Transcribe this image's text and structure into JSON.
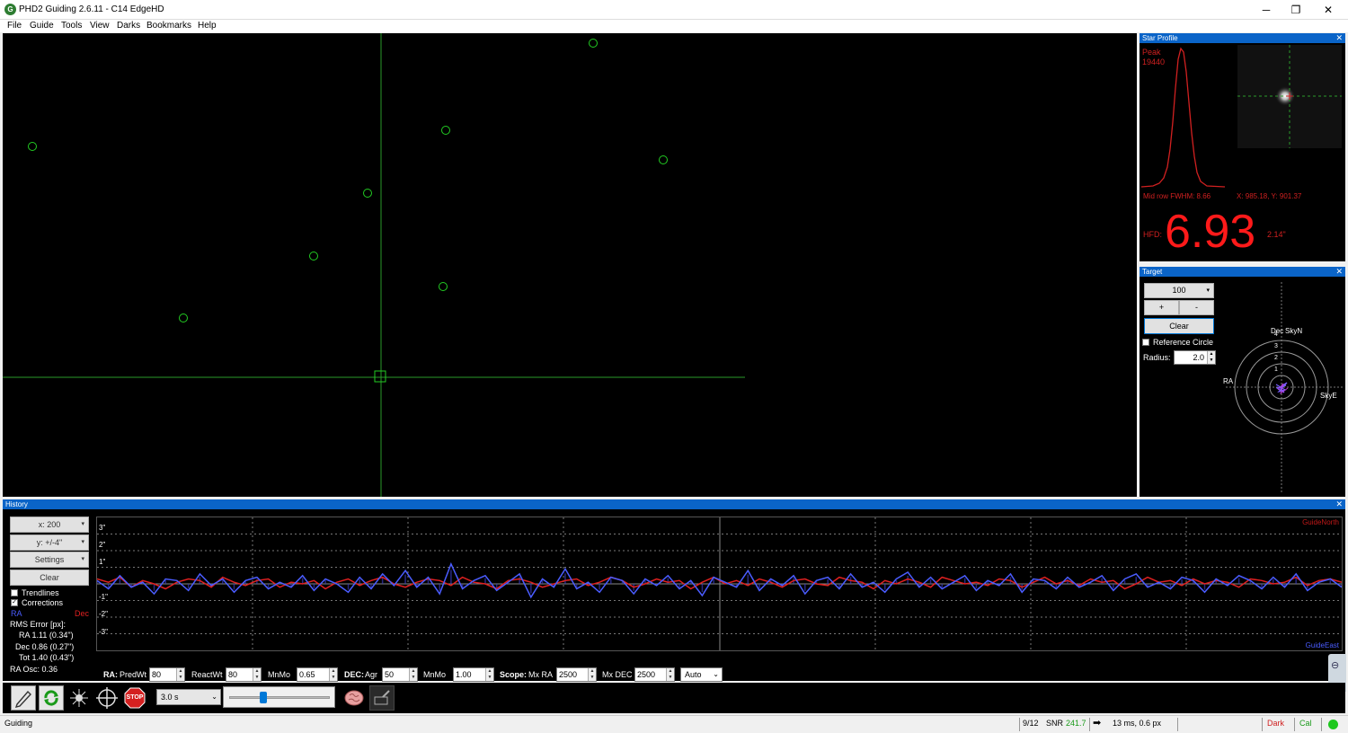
{
  "window": {
    "title": "PHD2 Guiding 2.6.11 - C14 EdgeHD",
    "minimize": "─",
    "maximize": "❐",
    "close": "✕"
  },
  "menu": [
    "File",
    "Guide",
    "Tools",
    "View",
    "Darks",
    "Bookmarks",
    "Help"
  ],
  "star_profile": {
    "title": "Star Profile",
    "peak_label": "Peak",
    "peak_value": "19440",
    "fwhm": "Mid row FWHM: 8.66",
    "coords": "X: 985.18, Y: 901.37",
    "hfd_label": "HFD:",
    "hfd_value": "6.93",
    "hfd_arcsec": "2.14\""
  },
  "target": {
    "title": "Target",
    "scale": "100",
    "plus": "+",
    "minus": "-",
    "clear": "Clear",
    "reference_circle": "Reference Circle",
    "radius_label": "Radius:",
    "radius_value": "2.0",
    "dec_label": "Dec",
    "skyn_label": "SkyN",
    "ra_label": "RA",
    "skye_label": "SkyE",
    "ring_labels": [
      "4",
      "3",
      "2",
      "1"
    ]
  },
  "history": {
    "title": "History",
    "x_scale": "x: 200",
    "y_scale": "y: +/-4\"",
    "settings": "Settings",
    "clear": "Clear",
    "trendlines": "Trendlines",
    "corrections": "Corrections",
    "ra_legend": "RA",
    "dec_legend": "Dec",
    "rms_title": "RMS Error [px]:",
    "rms_ra": "RA  1.11 (0.34\")",
    "rms_dec": "Dec  0.86 (0.27\")",
    "rms_tot": "Tot  1.40 (0.43\")",
    "ra_osc": "RA Osc: 0.36",
    "guide_north": "GuideNorth",
    "guide_east": "GuideEast",
    "y_ticks": [
      "3\"",
      "2\"",
      "1\"",
      "-1\"",
      "-2\"",
      "-3\""
    ]
  },
  "controls": {
    "ra_label": "RA:",
    "predwt_label": "PredWt",
    "predwt": "80",
    "reactwt_label": "ReactWt",
    "reactwt": "80",
    "mnmo_label": "MnMo",
    "ra_mnmo": "0.65",
    "dec_label": "DEC:",
    "agr_label": "Agr",
    "dec_agr": "50",
    "dec_mnmo_label": "MnMo",
    "dec_mnmo": "1.00",
    "scope_label": "Scope:",
    "mxra_label": "Mx RA",
    "mx_ra": "2500",
    "mxdec_label": "Mx DEC",
    "mx_dec": "2500",
    "mode": "Auto"
  },
  "toolbar": {
    "exposure": "3.0 s",
    "stop": "STOP"
  },
  "status": {
    "mode": "Guiding",
    "frame": "9/12",
    "snr_label": "SNR",
    "snr_value": "241.7",
    "arrow": "➡",
    "pulse": "13 ms, 0.6 px",
    "dark": "Dark",
    "cal": "Cal"
  },
  "colors": {
    "ra": "#4a5cff",
    "dec": "#e02020",
    "star_circle": "#22cc22",
    "pane_title": "#0a64c8"
  },
  "chart_data": {
    "type": "line",
    "ylim": [
      -4,
      4
    ],
    "series": [
      {
        "name": "RA",
        "values": [
          0.2,
          -0.3,
          0.5,
          -0.2,
          0.1,
          -0.6,
          0.3,
          0.2,
          -0.4,
          0.6,
          -0.1,
          0.3,
          -0.5,
          0.2,
          0.4,
          -0.3,
          0.1,
          -0.2,
          0.5,
          -0.4,
          0.3,
          0.0,
          -0.5,
          0.4,
          -0.3,
          0.6,
          -0.1,
          0.8,
          -0.2,
          0.4,
          -0.6,
          1.2,
          -0.3,
          0.2,
          0.5,
          -0.4,
          0.1,
          0.6,
          -0.8,
          0.3,
          -0.2,
          0.9,
          -0.3,
          0.1,
          -0.5,
          0.4,
          0.2,
          -0.6,
          0.3,
          -0.1,
          0.5,
          -0.3,
          0.2,
          -0.7,
          0.4,
          0.1,
          -0.2,
          0.8,
          -0.4,
          0.3,
          -0.1,
          0.5,
          -0.6,
          0.2,
          0.4,
          -0.3,
          0.6,
          -0.2,
          0.1,
          -0.5,
          0.3,
          0.7,
          -0.2,
          0.4,
          -0.3,
          0.1,
          0.5,
          -0.4,
          0.2,
          -0.1,
          0.6,
          -0.5,
          0.3,
          0.2,
          -0.3,
          0.4,
          -0.2,
          0.1,
          0.5,
          -0.4,
          0.3,
          0.6,
          -0.2,
          0.1,
          -0.3,
          0.4,
          0.2,
          -0.5,
          0.3,
          -0.1,
          0.5,
          0.2,
          -0.3,
          0.4,
          -0.2,
          0.6,
          -0.4,
          0.1,
          0.3,
          -0.2
        ]
      },
      {
        "name": "Dec",
        "values": [
          0.3,
          0.1,
          0.4,
          -0.2,
          0.2,
          0.0,
          -0.3,
          0.1,
          0.3,
          0.2,
          -0.2,
          0.4,
          0.1,
          -0.1,
          0.2,
          0.3,
          -0.2,
          0.1,
          0.0,
          0.2,
          -0.3,
          0.1,
          0.3,
          -0.1,
          0.2,
          0.4,
          0.0,
          -0.2,
          0.1,
          0.3,
          0.2,
          -0.1,
          0.4,
          0.1,
          0.0,
          -0.3,
          0.2,
          0.3,
          0.1,
          -0.2,
          0.0,
          0.2,
          0.3,
          -0.1,
          0.1,
          0.4,
          0.2,
          -0.2,
          0.0,
          0.3,
          0.1,
          0.2,
          -0.3,
          0.1,
          0.4,
          0.0,
          0.2,
          -0.1,
          0.3,
          0.1,
          -0.2,
          0.2,
          0.3,
          0.0,
          -0.1,
          0.4,
          0.2,
          0.1,
          -0.3,
          0.2,
          0.0,
          0.3,
          0.1,
          -0.2,
          0.4,
          0.2,
          0.0,
          0.1,
          -0.1,
          0.3,
          0.2,
          -0.2,
          0.1,
          0.4,
          0.0,
          0.2,
          -0.1,
          0.3,
          0.1,
          0.2,
          -0.3,
          0.0,
          0.4,
          0.1,
          0.2,
          -0.1,
          0.3,
          0.0,
          0.2,
          0.1,
          -0.2,
          0.3,
          0.2,
          0.0,
          0.1,
          0.4,
          -0.1,
          0.2,
          0.3,
          0.1
        ]
      }
    ]
  }
}
